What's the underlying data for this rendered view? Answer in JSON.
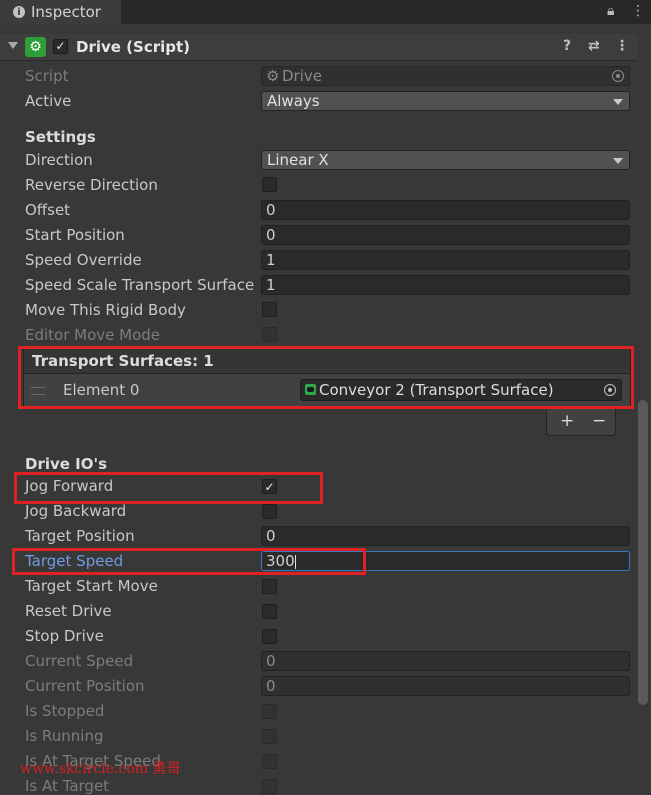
{
  "tab": {
    "title": "Inspector"
  },
  "component": {
    "title": "Drive (Script)"
  },
  "rows": {
    "script": {
      "label": "Script",
      "value": "Drive"
    },
    "active": {
      "label": "Active",
      "value": "Always"
    },
    "settings": {
      "label": "Settings"
    },
    "direction": {
      "label": "Direction",
      "value": "Linear X"
    },
    "reverse_direction": {
      "label": "Reverse Direction"
    },
    "offset": {
      "label": "Offset",
      "value": "0"
    },
    "start_position": {
      "label": "Start Position",
      "value": "0"
    },
    "speed_override": {
      "label": "Speed Override",
      "value": "1"
    },
    "speed_scale": {
      "label": "Speed Scale Transport Surface",
      "value": "1"
    },
    "move_rigid_body": {
      "label": "Move This Rigid Body"
    },
    "editor_move_mode": {
      "label": "Editor Move Mode"
    }
  },
  "transport_surfaces": {
    "header": "Transport Surfaces: 1",
    "element_label": "Element 0",
    "element_value": "Conveyor 2 (Transport Surface)",
    "add": "+",
    "remove": "−"
  },
  "drive_io": {
    "header": "Drive IO's",
    "jog_forward": {
      "label": "Jog Forward",
      "checked": true
    },
    "jog_backward": {
      "label": "Jog Backward"
    },
    "target_position": {
      "label": "Target Position",
      "value": "0"
    },
    "target_speed": {
      "label": "Target Speed",
      "value": "300"
    },
    "target_start_move": {
      "label": "Target Start Move"
    },
    "reset_drive": {
      "label": "Reset Drive"
    },
    "stop_drive": {
      "label": "Stop Drive"
    },
    "current_speed": {
      "label": "Current Speed",
      "value": "0"
    },
    "current_position": {
      "label": "Current Position",
      "value": "0"
    },
    "is_stopped": {
      "label": "Is Stopped"
    },
    "is_running": {
      "label": "Is Running"
    },
    "is_at_target_speed": {
      "label": "Is At Target Speed"
    },
    "is_at_target": {
      "label": "Is At Target"
    }
  },
  "watermark": "www.skcircle.com 勇哥",
  "colors": {
    "highlight": "#e02222",
    "accent": "#4a8be0",
    "component_icon": "#2e9e38"
  }
}
